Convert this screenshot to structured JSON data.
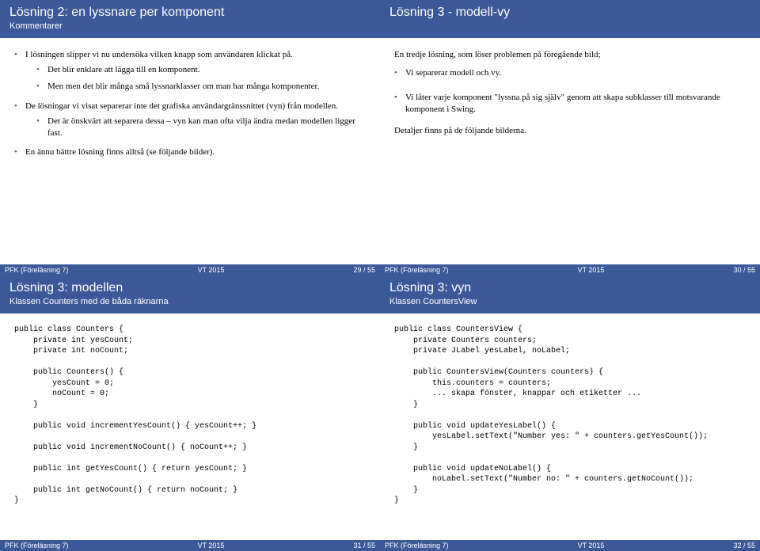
{
  "slides": [
    {
      "title": "Lösning 2: en lyssnare per komponent",
      "subtitle": "Kommentarer",
      "footer_left": "PFK (Föreläsning 7)",
      "footer_center": "VT 2015",
      "footer_page": "29 / 55",
      "b1": "I lösningen slipper vi nu undersöka vilken knapp som användaren klickat på.",
      "b1a": "Det blir enklare att lägga till en komponent.",
      "b1b": "Men men det blir många små lyssnarklasser om man har många komponenter.",
      "b2": "De lösningar vi visat separerar inte det grafiska användargränssnittet (vyn) från modellen.",
      "b2a": "Det är önskvärt att separera dessa – vyn kan man ofta vilja ändra medan modellen ligger fast.",
      "b3": "En ännu bättre lösning finns alltså (se följande bilder)."
    },
    {
      "title": "Lösning 3 - modell-vy",
      "subtitle": "",
      "footer_left": "PFK (Föreläsning 7)",
      "footer_center": "VT 2015",
      "footer_page": "30 / 55",
      "p1": "En tredje lösning, som löser problemen på föregående bild;",
      "b1": "Vi separerar modell och vy.",
      "b2": "Vi låter varje komponent \"lyssna på sig själv\" genom att skapa subklasser till motsvarande komponent i Swing.",
      "p2": "Detaljer finns på de följande bilderna."
    },
    {
      "title": "Lösning 3: modellen",
      "subtitle": "Klassen Counters med de båda räknarna",
      "footer_left": "PFK (Föreläsning 7)",
      "footer_center": "VT 2015",
      "footer_page": "31 / 55",
      "code": "public class Counters {\n    private int yesCount;\n    private int noCount;\n\n    public Counters() {\n        yesCount = 0;\n        noCount = 0;\n    }\n\n    public void incrementYesCount() { yesCount++; }\n\n    public void incrementNoCount() { noCount++; }\n\n    public int getYesCount() { return yesCount; }\n\n    public int getNoCount() { return noCount; }\n}"
    },
    {
      "title": "Lösning 3: vyn",
      "subtitle": "Klassen CountersView",
      "footer_left": "PFK (Föreläsning 7)",
      "footer_center": "VT 2015",
      "footer_page": "32 / 55",
      "code": "public class CountersView {\n    private Counters counters;\n    private JLabel yesLabel, noLabel;\n\n    public CountersView(Counters counters) {\n        this.counters = counters;\n        ... skapa fönster, knappar och etiketter ...\n    }\n\n    public void updateYesLabel() {\n        yesLabel.setText(\"Number yes: \" + counters.getYesCount());\n    }\n\n    public void updateNoLabel() {\n        noLabel.setText(\"Number no: \" + counters.getNoCount());\n    }\n}"
    }
  ]
}
